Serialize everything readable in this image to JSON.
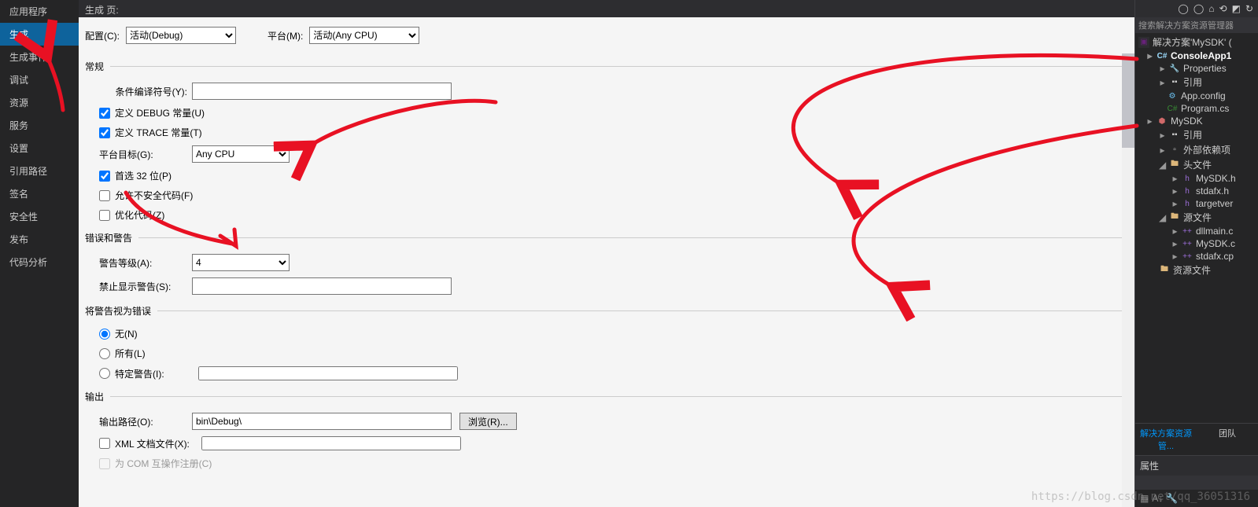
{
  "header": {
    "title": "生成 页:"
  },
  "leftNav": {
    "items": [
      "应用程序",
      "生成",
      "生成事件",
      "调试",
      "资源",
      "服务",
      "设置",
      "引用路径",
      "签名",
      "安全性",
      "发布",
      "代码分析"
    ],
    "activeIndex": 1
  },
  "configBar": {
    "configLabel": "配置(C):",
    "configValue": "活动(Debug)",
    "platformLabel": "平台(M):",
    "platformValue": "活动(Any CPU)"
  },
  "sections": {
    "general": {
      "title": "常规",
      "condSymbolsLabel": "条件编译符号(Y):",
      "condSymbolsValue": "",
      "defineDebug": {
        "label": "定义 DEBUG 常量(U)",
        "checked": true
      },
      "defineTrace": {
        "label": "定义 TRACE 常量(T)",
        "checked": true
      },
      "platformTargetLabel": "平台目标(G):",
      "platformTargetValue": "Any CPU",
      "prefer32": {
        "label": "首选 32 位(P)",
        "checked": true
      },
      "allowUnsafe": {
        "label": "允许不安全代码(F)",
        "checked": false
      },
      "optimize": {
        "label": "优化代码(Z)",
        "checked": false
      }
    },
    "warnings": {
      "title": "错误和警告",
      "levelLabel": "警告等级(A):",
      "levelValue": "4",
      "suppressLabel": "禁止显示警告(S):",
      "suppressValue": ""
    },
    "treatAsErrors": {
      "title": "将警告视为错误",
      "none": "无(N)",
      "all": "所有(L)",
      "specific": "特定警告(I):",
      "specificValue": "",
      "selected": "none"
    },
    "output": {
      "title": "输出",
      "outPathLabel": "输出路径(O):",
      "outPathValue": "bin\\Debug\\",
      "browseLabel": "浏览(R)...",
      "xmlDoc": {
        "label": "XML 文档文件(X):",
        "checked": false,
        "value": ""
      },
      "comInterop": {
        "label": "为 COM 互操作注册(C)",
        "checked": false
      }
    }
  },
  "solutionExplorer": {
    "searchPlaceholder": "搜索解决方案资源管理器",
    "solutionLabel": "解决方案'MySDK' (",
    "project1": {
      "name": "ConsoleApp1",
      "properties": "Properties",
      "references": "引用",
      "appConfig": "App.config",
      "programCs": "Program.cs"
    },
    "project2": {
      "name": "MySDK",
      "references": "引用",
      "externalDeps": "外部依赖项",
      "headers": {
        "label": "头文件",
        "files": [
          "MySDK.h",
          "stdafx.h",
          "targetver"
        ]
      },
      "sources": {
        "label": "源文件",
        "files": [
          "dllmain.c",
          "MySDK.c",
          "stdafx.cp"
        ]
      },
      "resources": "资源文件"
    },
    "tabs": {
      "active": "解决方案资源管...",
      "other": "团队"
    }
  },
  "propertiesPanel": {
    "title": "属性"
  },
  "watermark": "https://blog.csdn.net/qq_36051316"
}
